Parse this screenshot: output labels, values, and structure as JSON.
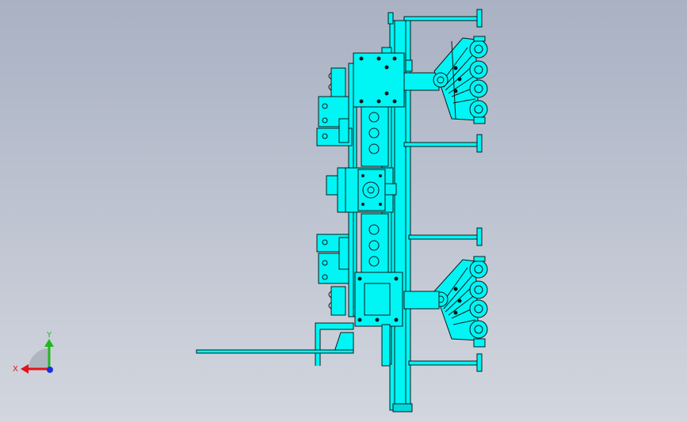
{
  "viewport": {
    "background_top": "#a9b1c3",
    "background_bottom": "#d2d6de"
  },
  "model": {
    "fill_color": "#00f5f5",
    "edge_color": "#0a1a1a",
    "shade_color": "#00c8cc"
  },
  "triad": {
    "x_label": "X",
    "y_label": "Y",
    "x_color": "#e3141a",
    "y_color": "#1fb81f",
    "z_color": "#1a2ee0"
  }
}
